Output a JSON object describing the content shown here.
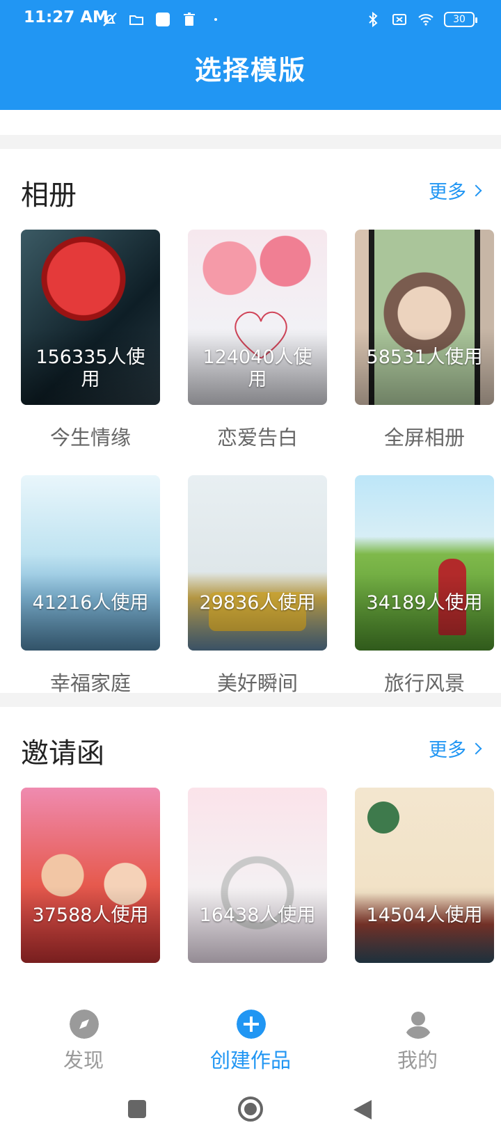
{
  "status_bar": {
    "time": "11:27 AM",
    "battery": "30",
    "icons_left": [
      "muted-notification-icon",
      "folder-icon",
      "square-app-icon",
      "trash-icon",
      "dot-icon"
    ],
    "icons_right": [
      "bluetooth-icon",
      "no-sim-icon",
      "wifi-icon",
      "battery-icon"
    ]
  },
  "header": {
    "title": "选择模版"
  },
  "colors": {
    "accent": "#2196F3",
    "text_primary": "#222222",
    "text_secondary": "#666666",
    "nav_inactive": "#9a9a9a"
  },
  "sections": [
    {
      "title": "相册",
      "more_label": "更多",
      "items": [
        {
          "label": "今生情缘",
          "count": "156335人使用"
        },
        {
          "label": "恋爱告白",
          "count": "124040人使用"
        },
        {
          "label": "全屏相册",
          "count": "58531人使用"
        },
        {
          "label": "幸福家庭",
          "count": "41216人使用"
        },
        {
          "label": "美好瞬间",
          "count": "29836人使用"
        },
        {
          "label": "旅行风景",
          "count": "34189人使用"
        }
      ]
    },
    {
      "title": "邀请函",
      "more_label": "更多",
      "items": [
        {
          "label": "",
          "count": "37588人使用"
        },
        {
          "label": "",
          "count": "16438人使用"
        },
        {
          "label": "",
          "count": "14504人使用"
        }
      ]
    }
  ],
  "bottom_nav": [
    {
      "label": "发现",
      "icon": "compass-icon",
      "active": false
    },
    {
      "label": "创建作品",
      "icon": "plus-circle-icon",
      "active": true
    },
    {
      "label": "我的",
      "icon": "person-icon",
      "active": false
    }
  ],
  "system_nav": [
    "recents-square-icon",
    "home-circle-icon",
    "back-triangle-icon"
  ]
}
